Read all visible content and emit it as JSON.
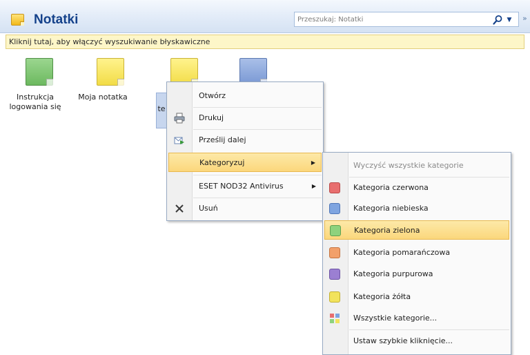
{
  "header": {
    "title": "Notatki",
    "search_placeholder": "Przeszukaj: Notatki",
    "expand_glyph": "»"
  },
  "infobar": {
    "text": "Kliknij tutaj, aby włączyć wyszukiwanie błyskawiczne"
  },
  "notes": [
    {
      "label": "Instrukcja logowania się",
      "color": "#7cc66f"
    },
    {
      "label": "Moja notatka",
      "color": "#f6e86a"
    },
    {
      "label": "",
      "color": "#f6e86a"
    },
    {
      "label": "",
      "color": "#8fa9dc"
    }
  ],
  "hidden_note": {
    "label_fragment": "te"
  },
  "context_menu": {
    "items": [
      {
        "label": "Otwórz",
        "icon": "open-icon"
      },
      {
        "label": "Drukuj",
        "icon": "printer-icon"
      },
      {
        "label": "Prześlij dalej",
        "icon": "forward-icon"
      },
      {
        "label": "Kategoryzuj",
        "icon": "",
        "submenu": true,
        "highlighted": true
      },
      {
        "label": "ESET NOD32 Antivirus",
        "icon": "",
        "submenu": true
      },
      {
        "label": "Usuń",
        "icon": "delete-icon"
      }
    ]
  },
  "submenu": {
    "items": [
      {
        "label": "Wyczyść wszystkie kategorie",
        "disabled": true
      },
      {
        "label": "Kategoria czerwona",
        "color": "#e86e6e"
      },
      {
        "label": "Kategoria niebieska",
        "color": "#7ea4e0"
      },
      {
        "label": "Kategoria zielona",
        "color": "#8ed27d",
        "highlighted": true
      },
      {
        "label": "Kategoria pomarańczowa",
        "color": "#f2a06a"
      },
      {
        "label": "Kategoria purpurowa",
        "color": "#9b7fd2"
      },
      {
        "label": "Kategoria żółta",
        "color": "#f2e35c"
      },
      {
        "label": "Wszystkie kategorie...",
        "icon": "all-categories-icon"
      },
      {
        "label": "Ustaw szybkie kliknięcie..."
      }
    ]
  },
  "colors": {
    "accent": "#15428b",
    "highlight": "#fbd77c"
  }
}
